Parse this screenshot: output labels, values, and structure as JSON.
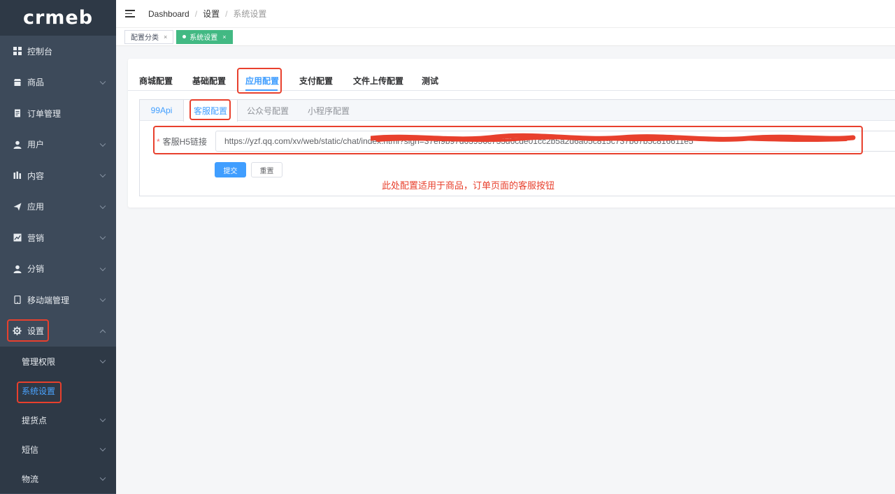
{
  "logo": "crmeb",
  "sidebar": {
    "items": [
      {
        "label": "控制台",
        "icon": "dashboard-icon",
        "has_children": false
      },
      {
        "label": "商品",
        "icon": "shop-icon",
        "has_children": true
      },
      {
        "label": "订单管理",
        "icon": "order-icon",
        "has_children": false
      },
      {
        "label": "用户",
        "icon": "user-icon",
        "has_children": true
      },
      {
        "label": "内容",
        "icon": "content-icon",
        "has_children": true
      },
      {
        "label": "应用",
        "icon": "send-icon",
        "has_children": true
      },
      {
        "label": "营销",
        "icon": "chart-icon",
        "has_children": true
      },
      {
        "label": "分销",
        "icon": "user-icon",
        "has_children": true
      },
      {
        "label": "移动端管理",
        "icon": "mobile-icon",
        "has_children": true
      },
      {
        "label": "设置",
        "icon": "gear-icon",
        "has_children": true,
        "expanded": true
      }
    ],
    "submenu": [
      {
        "label": "管理权限",
        "has_children": true
      },
      {
        "label": "系统设置",
        "active": true
      },
      {
        "label": "提货点",
        "has_children": true
      },
      {
        "label": "短信",
        "has_children": true
      },
      {
        "label": "物流",
        "has_children": true
      }
    ]
  },
  "header": {
    "breadcrumb": [
      "Dashboard",
      "设置",
      "系统设置"
    ]
  },
  "tags": [
    {
      "label": "配置分类",
      "close": "×",
      "active": false
    },
    {
      "label": "系统设置",
      "close": "×",
      "active": true
    }
  ],
  "config_tabs": [
    "商城配置",
    "基础配置",
    "应用配置",
    "支付配置",
    "文件上传配置",
    "测试"
  ],
  "config_active": "应用配置",
  "sub_tabs": [
    "99Api",
    "客服配置",
    "公众号配置",
    "小程序配置"
  ],
  "sub_active": "客服配置",
  "form": {
    "required_mark": "*",
    "label": "客服H5链接",
    "value": "https://yzf.qq.com/xv/web/static/chat/index.html?sign=37ef9b97d63956c733d6cde01cc2b5a2d6a05c815c737b67b5c816611e5",
    "submit": "提交",
    "reset": "重置"
  },
  "annotation": "此处配置适用于商品，订单页面的客服按钮",
  "colors": {
    "sidebar_bg": "#3d4a5a",
    "accent": "#409eff",
    "tag_active": "#42b983",
    "highlight": "#e8402d"
  }
}
